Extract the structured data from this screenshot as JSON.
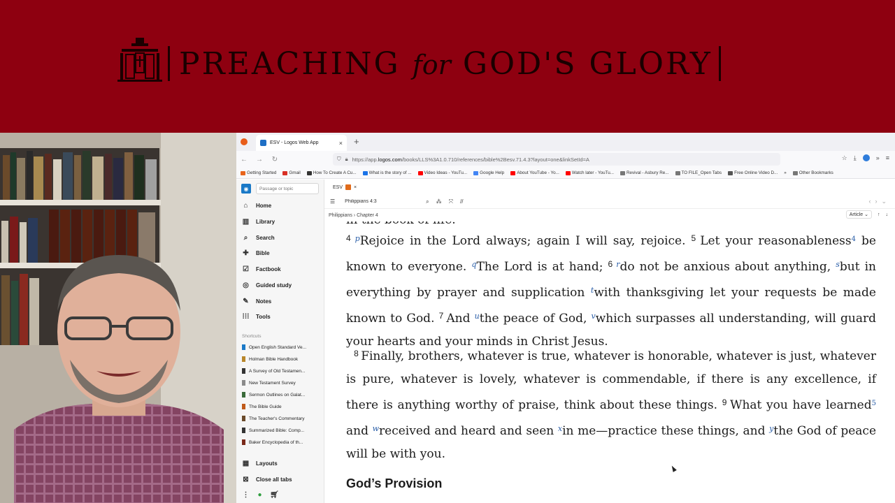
{
  "banner": {
    "title_part1": "PREACHING",
    "title_italic": "for",
    "title_part2": "GOD'S GLORY"
  },
  "browser": {
    "tab_title": "ESV - Logos Web App",
    "url_prefix": "https://app.",
    "url_domain": "logos.com",
    "url_path": "/books/LLS%3A1.0.710/references/bible%2Besv.71.4.3?layout=one&linkSetId=A",
    "bookmarks": [
      {
        "label": "Getting Started",
        "color": "#e8641b"
      },
      {
        "label": "Gmail",
        "color": "#d93025"
      },
      {
        "label": "How To Create A Cu...",
        "color": "#333333"
      },
      {
        "label": "What is the story of ...",
        "color": "#1a73e8"
      },
      {
        "label": "Video Ideas - YouTu...",
        "color": "#ff0000"
      },
      {
        "label": "Google Help",
        "color": "#4285f4"
      },
      {
        "label": "About YouTube - Yo...",
        "color": "#ff0000"
      },
      {
        "label": "Watch later - YouTu...",
        "color": "#ff0000"
      },
      {
        "label": "Revival - Asbury Re...",
        "color": "#777777"
      },
      {
        "label": "TO FILE_Open Tabs",
        "color": "#777777"
      },
      {
        "label": "Free Online Video D...",
        "color": "#555555"
      },
      {
        "label": "Other Bookmarks",
        "color": "#777777"
      }
    ]
  },
  "logos": {
    "passage_placeholder": "Passage or topic",
    "nav": [
      "Home",
      "Library",
      "Search",
      "Bible",
      "Factbook",
      "Guided study",
      "Notes",
      "Tools"
    ],
    "shortcuts_label": "Shortcuts",
    "shortcuts": [
      "Open English Standard Ve...",
      "Holman Bible Handbook",
      "A Survey of Old Testamen...",
      "New Testament Survey",
      "Sermon Outlines on Galat...",
      "The Bible Guide",
      "The Teacher's Commentary",
      "Summarized Bible: Comp...",
      "Baker Encyclopedia of th..."
    ],
    "layouts": "Layouts",
    "close_all": "Close all tabs",
    "panel_tab": "ESV",
    "reference": "Philippians 4:3",
    "breadcrumb": "Philippians › Chapter 4",
    "view_mode": "Article",
    "cut_line": "in the book of life.",
    "heading": "God’s Provision"
  }
}
